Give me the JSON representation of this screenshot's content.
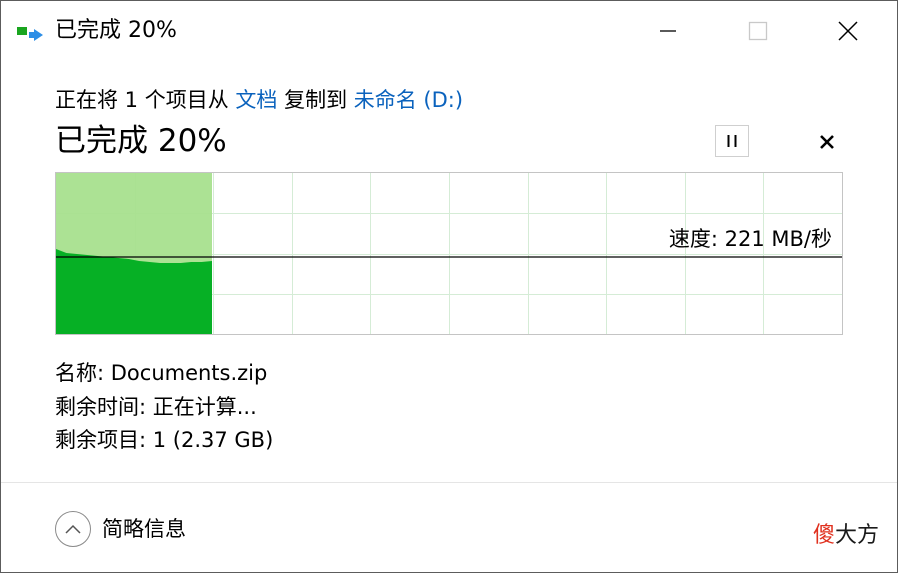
{
  "window": {
    "title": "已完成 20%",
    "app_icon": "copy-transfer-icon",
    "controls": {
      "minimize_icon": "minimize-icon",
      "maximize_icon": "maximize-icon",
      "close_icon": "close-icon"
    }
  },
  "copy": {
    "prefix": "正在将 1 个项目从 ",
    "source": "文档",
    "middle": " 复制到 ",
    "destination": "未命名 (D:)"
  },
  "progress": {
    "heading": "已完成 20%",
    "percent": 20,
    "pause_icon": "pause-icon",
    "cancel_icon": "cancel-x-icon"
  },
  "graph": {
    "speed_label": "速度: 221 MB/秒",
    "colors": {
      "completed_fill": "#a8e08e",
      "speed_fill": "#06b025",
      "grid": "#d5ecd6",
      "speed_line": "#000000"
    }
  },
  "details": {
    "name": "名称:  Documents.zip",
    "time_remaining": "剩余时间:  正在计算...",
    "items_remaining": "剩余项目:  1 (2.37 GB)"
  },
  "footer": {
    "toggle_icon": "chevron-up-icon",
    "toggle_label": "简略信息",
    "watermark_red": "傻",
    "watermark_rest": "大方"
  }
}
